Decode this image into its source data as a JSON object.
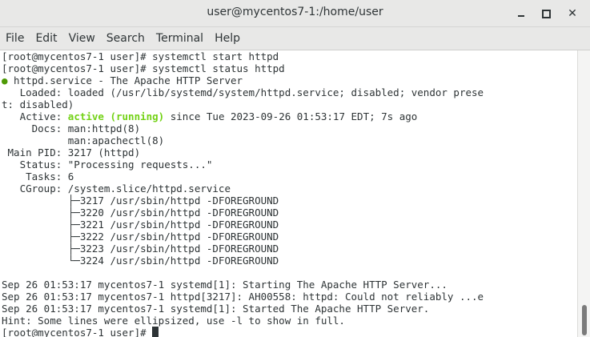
{
  "window": {
    "title": "user@mycentos7-1:/home/user"
  },
  "menubar": {
    "items": [
      "File",
      "Edit",
      "View",
      "Search",
      "Terminal",
      "Help"
    ]
  },
  "terminal": {
    "lines": [
      "[root@mycentos7-1 user]# systemctl start httpd",
      "[root@mycentos7-1 user]# systemctl status httpd",
      "● httpd.service - The Apache HTTP Server",
      "   Loaded: loaded (/usr/lib/systemd/system/httpd.service; disabled; vendor prese",
      "t: disabled)",
      "   Active: active (running) since Tue 2023-09-26 01:53:17 EDT; 7s ago",
      "     Docs: man:httpd(8)",
      "           man:apachectl(8)",
      " Main PID: 3217 (httpd)",
      "   Status: \"Processing requests...\"",
      "    Tasks: 6",
      "   CGroup: /system.slice/httpd.service",
      "           ├─3217 /usr/sbin/httpd -DFOREGROUND",
      "           ├─3220 /usr/sbin/httpd -DFOREGROUND",
      "           ├─3221 /usr/sbin/httpd -DFOREGROUND",
      "           ├─3222 /usr/sbin/httpd -DFOREGROUND",
      "           ├─3223 /usr/sbin/httpd -DFOREGROUND",
      "           └─3224 /usr/sbin/httpd -DFOREGROUND",
      "",
      "Sep 26 01:53:17 mycentos7-1 systemd[1]: Starting The Apache HTTP Server...",
      "Sep 26 01:53:17 mycentos7-1 httpd[3217]: AH00558: httpd: Could not reliably ...e",
      "Sep 26 01:53:17 mycentos7-1 systemd[1]: Started The Apache HTTP Server.",
      "Hint: Some lines were ellipsized, use -l to show in full.",
      "[root@mycentos7-1 user]# "
    ],
    "status_dot_color": "#4e9a06",
    "active_color": "#73d216",
    "active_text": "active (running)"
  }
}
